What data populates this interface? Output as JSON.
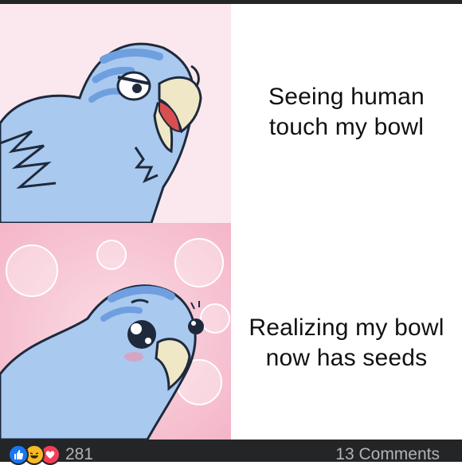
{
  "meme": {
    "top_caption": [
      "Seeing human",
      "touch my bowl"
    ],
    "bottom_caption": [
      "Realizing my bowl",
      "now has seeds"
    ]
  },
  "footer": {
    "reaction_icons": [
      "like-icon",
      "haha-icon",
      "love-icon"
    ],
    "reaction_count": "281",
    "comments_label": "13 Comments"
  },
  "colors": {
    "footer_bg": "#242526",
    "footer_text": "#b0b3b8",
    "like": "#1877f2",
    "haha": "#f7b928",
    "love": "#f33e58",
    "bird_blue": "#a9c9ef",
    "bird_stripe": "#6f9fdf",
    "beak": "#efe7c6",
    "panel_top_bg": "#fbe8ee",
    "panel_bottom_bg": "#f7c8d6"
  }
}
